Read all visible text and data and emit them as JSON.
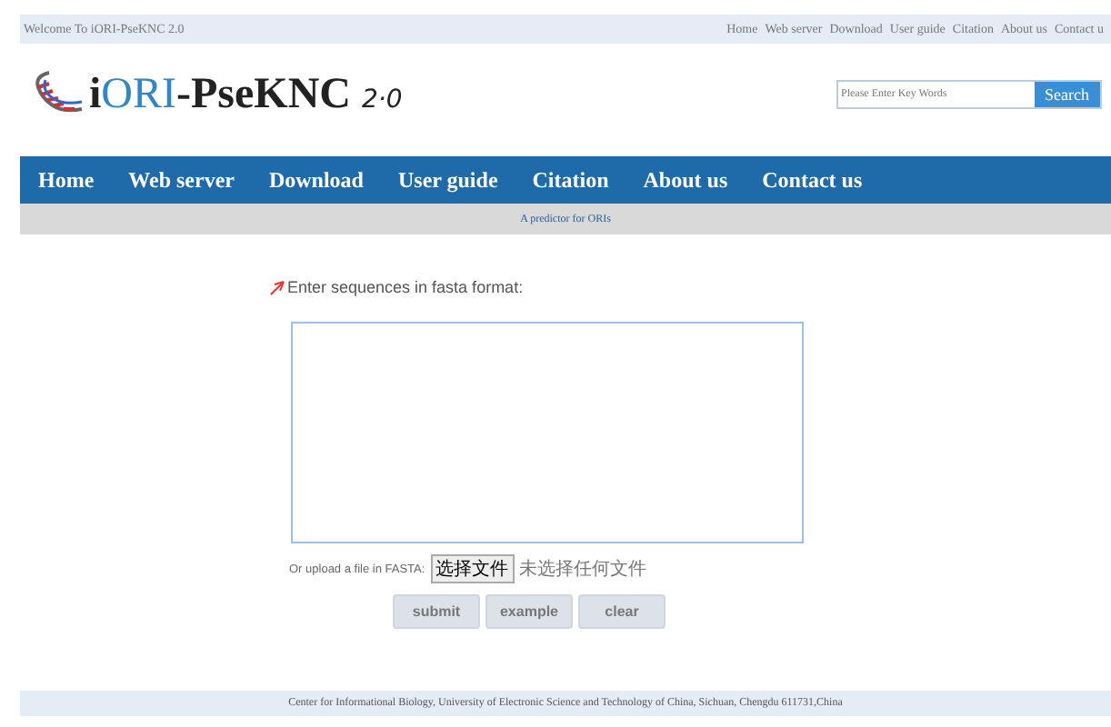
{
  "top_bar": {
    "welcome": "Welcome To iORI-PseKNC 2.0",
    "links": [
      "Home",
      "Web server",
      "Download",
      "User guide",
      "Citation",
      "About us",
      "Contact u"
    ]
  },
  "logo": {
    "prefix": "i",
    "highlight": "ORI",
    "suffix": "-PseKNC",
    "version": "2·0"
  },
  "search": {
    "placeholder": "Please Enter Key Words",
    "button": "Search"
  },
  "nav": [
    {
      "label": "Home"
    },
    {
      "label": "Web server"
    },
    {
      "label": "Download"
    },
    {
      "label": "User guide"
    },
    {
      "label": "Citation"
    },
    {
      "label": "About us"
    },
    {
      "label": "Contact us"
    }
  ],
  "subtitle": "A predictor for ORIs",
  "form": {
    "prompt": "Enter sequences in fasta format:",
    "upload_label": "Or upload a file in FASTA:",
    "file_button": "选择文件",
    "file_status": "未选择任何文件",
    "buttons": [
      "submit",
      "example",
      "clear"
    ]
  },
  "footer": "Center for Informational Biology, University of Electronic Science and Technology of China, Sichuan, Chengdu 611731,China"
}
